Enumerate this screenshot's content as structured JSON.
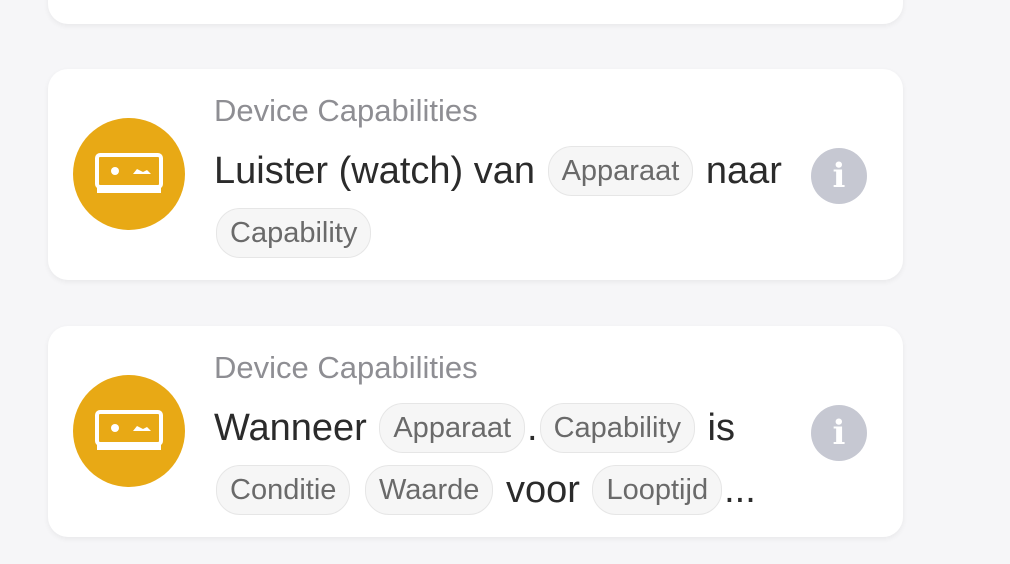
{
  "cards": [
    {
      "category": "Device Capabilities",
      "parts": {
        "t1": "Luister (watch) van",
        "c1": "Apparaat",
        "t2": "naar",
        "c2": "Capability"
      },
      "icon": "device-capabilities-icon",
      "info_icon_glyph": "i"
    },
    {
      "category": "Device Capabilities",
      "parts": {
        "t1": "Wanneer",
        "c1": "Apparaat",
        "sep": ".",
        "c2": "Capability",
        "t2": "is",
        "c3": "Conditie",
        "c4": "Waarde",
        "t3": "voor",
        "c5": "Looptijd",
        "ellipsis": "..."
      },
      "icon": "device-capabilities-icon",
      "info_icon_glyph": "i"
    }
  ],
  "colors": {
    "icon_background": "#e8a915",
    "info_button": "#c6c8d2",
    "category_text": "#8e8e93",
    "background": "#f6f6f8"
  }
}
